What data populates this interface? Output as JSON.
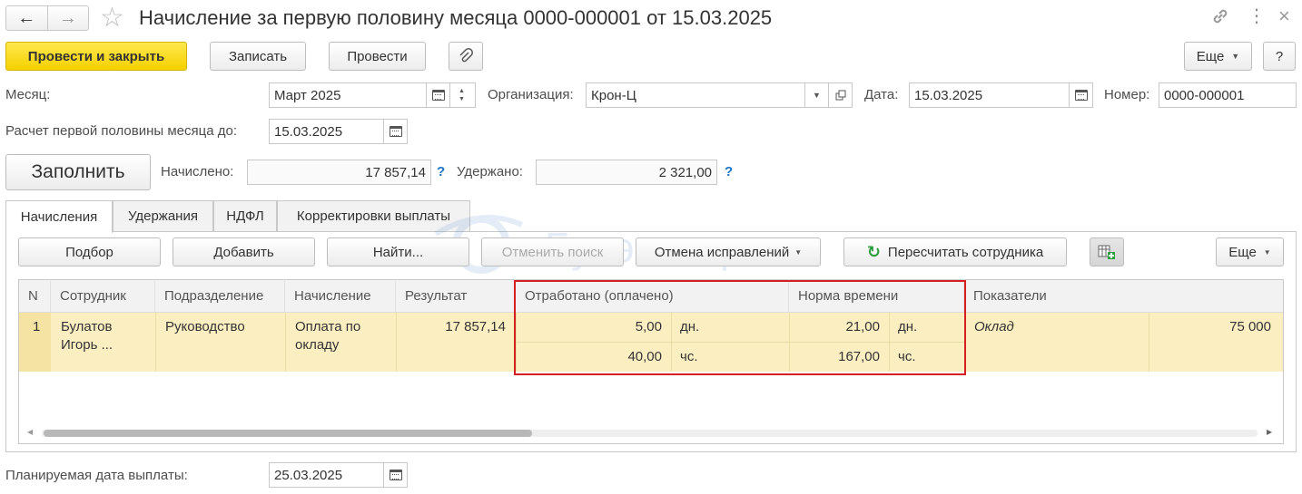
{
  "window": {
    "title": "Начисление за первую половину месяца 0000-000001 от 15.03.2025"
  },
  "toolbar": {
    "post_close": "Провести и закрыть",
    "save": "Записать",
    "post": "Провести",
    "more": "Еще",
    "help": "?"
  },
  "header": {
    "month_label": "Месяц:",
    "month_value": "Март 2025",
    "org_label": "Организация:",
    "org_value": "Крон-Ц",
    "date_label": "Дата:",
    "date_value": "15.03.2025",
    "number_label": "Номер:",
    "number_value": "0000-000001",
    "calc_until_label": "Расчет первой половины месяца до:",
    "calc_until_value": "15.03.2025"
  },
  "totals": {
    "fill_button": "Заполнить",
    "accrued_label": "Начислено:",
    "accrued_value": "17 857,14",
    "withheld_label": "Удержано:",
    "withheld_value": "2 321,00",
    "help_mark": "?"
  },
  "tabs": [
    {
      "label": "Начисления",
      "active": true
    },
    {
      "label": "Удержания",
      "active": false
    },
    {
      "label": "НДФЛ",
      "active": false
    },
    {
      "label": "Корректировки выплаты",
      "active": false
    }
  ],
  "table_toolbar": {
    "select": "Подбор",
    "add": "Добавить",
    "find": "Найти...",
    "cancel_search": "Отменить поиск",
    "cancel_fixes": "Отмена исправлений",
    "recalc": "Пересчитать сотрудника",
    "more": "Еще"
  },
  "watermark": "Бухэксперт",
  "table": {
    "columns": [
      "N",
      "Сотрудник",
      "Подразделение",
      "Начисление",
      "Результат",
      "Отработано (оплачено)",
      "Норма времени",
      "Показатели"
    ],
    "rows": [
      {
        "n": "1",
        "employee": "Булатов Игорь ...",
        "employee_line1": "Булатов",
        "employee_line2": "Игорь ...",
        "department": "Руководство",
        "accrual_line1": "Оплата по",
        "accrual_line2": "окладу",
        "result": "17 857,14",
        "worked_days": "5,00",
        "worked_days_unit": "дн.",
        "worked_hours": "40,00",
        "worked_hours_unit": "чс.",
        "norm_days": "21,00",
        "norm_days_unit": "дн.",
        "norm_hours": "167,00",
        "norm_hours_unit": "чс.",
        "indicator_name": "Оклад",
        "indicator_value": "75 000"
      }
    ]
  },
  "footer": {
    "pay_date_label": "Планируемая дата выплаты:",
    "pay_date_value": "25.03.2025"
  },
  "colors": {
    "accent_yellow": "#f5d000",
    "row_highlight": "#fbefc2",
    "highlight_box": "#d42020",
    "link_blue": "#1a73c8",
    "recalc_green": "#2e9e3e"
  }
}
